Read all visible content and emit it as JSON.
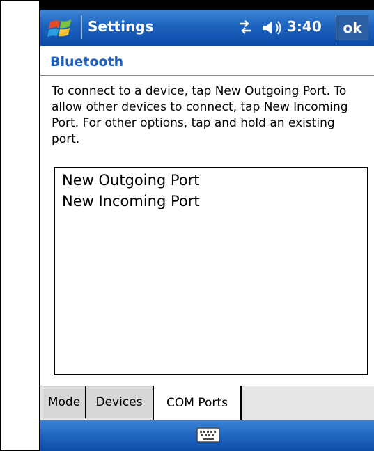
{
  "titlebar": {
    "app_title": "Settings",
    "clock": "3:40",
    "ok_label": "ok",
    "icons": [
      "windows-logo",
      "connectivity-icon",
      "volume-icon"
    ]
  },
  "page": {
    "title": "Bluetooth",
    "description": "To connect to a device, tap New Outgoing Port. To allow other devices to connect, tap New Incoming Port. For other options, tap and hold an existing port."
  },
  "ports": {
    "items": [
      "New Outgoing Port",
      "New Incoming Port"
    ]
  },
  "tabs": [
    {
      "label": "Mode"
    },
    {
      "label": "Devices"
    },
    {
      "label": "COM Ports",
      "active": true
    }
  ],
  "bottombar": {
    "icon": "keyboard-icon"
  },
  "colors": {
    "titlebar": "#1d63be",
    "title_text": "#1f5fbf"
  }
}
